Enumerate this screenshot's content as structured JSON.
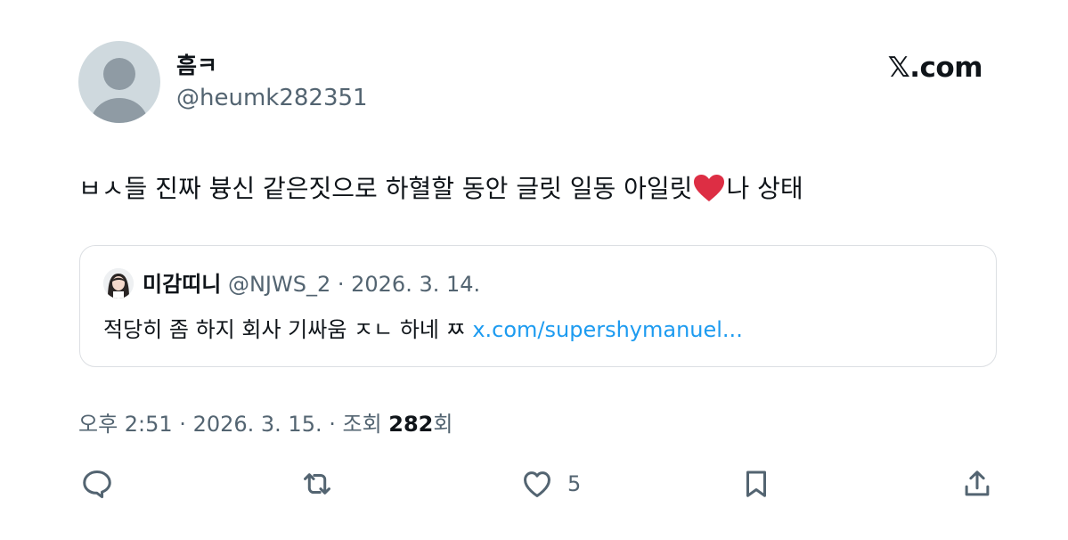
{
  "author": {
    "display_name": "흠ㅋ",
    "handle": "@heumk282351"
  },
  "brand": "𝕏.com",
  "tweet": {
    "text_before": "ㅂㅅ들 진짜 븅신 같은짓으로 하혈할 동안 글릿 일동 아일릿",
    "emoji": "heart",
    "text_after": "나 상태"
  },
  "quote": {
    "display_name": "미감띠니",
    "meta": "@NJWS_2 · 2026. 3. 14.",
    "text": "적당히 좀 하지 회사 기싸움 ㅈㄴ 하네 ㅉ ",
    "link": "x.com/supershymanuel..."
  },
  "meta": {
    "before": "오후 2:51 · 2026. 3. 15. · 조회 ",
    "views": "282",
    "after": "회"
  },
  "actions": {
    "reply_icon": "reply-icon",
    "retweet_icon": "retweet-icon",
    "like_icon": "heart-icon",
    "like_count": "5",
    "bookmark_icon": "bookmark-icon",
    "share_icon": "share-icon"
  },
  "colors": {
    "accent": "#1d9bf0",
    "secondary_text": "#536471",
    "primary_text": "#0f1419",
    "avatar_bg": "#cfd9de",
    "avatar_fg": "#8f9ba4"
  }
}
